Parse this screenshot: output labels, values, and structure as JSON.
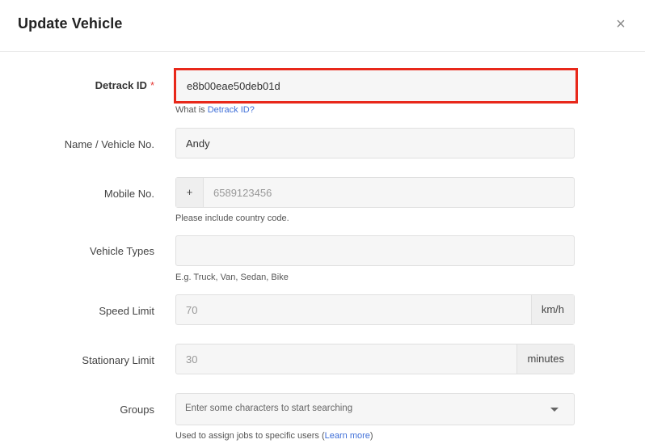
{
  "modal": {
    "title": "Update Vehicle",
    "close_glyph": "×"
  },
  "fields": {
    "detrack_id": {
      "label": "Detrack ID",
      "required_mark": "*",
      "value": "e8b00eae50deb01d",
      "help_prefix": "What is ",
      "help_link": "Detrack ID?"
    },
    "name": {
      "label": "Name / Vehicle No.",
      "value": "Andy"
    },
    "mobile": {
      "label": "Mobile No.",
      "prefix": "+",
      "placeholder": "6589123456",
      "help": "Please include country code."
    },
    "vehicle_types": {
      "label": "Vehicle Types",
      "value": "",
      "help": "E.g. Truck, Van, Sedan, Bike"
    },
    "speed_limit": {
      "label": "Speed Limit",
      "placeholder": "70",
      "suffix": "km/h"
    },
    "stationary_limit": {
      "label": "Stationary Limit",
      "placeholder": "30",
      "suffix": "minutes"
    },
    "groups": {
      "label": "Groups",
      "placeholder": "Enter some characters to start searching",
      "help_prefix": "Used to assign jobs to specific users (",
      "help_link": "Learn more",
      "help_suffix": ")"
    }
  },
  "colors": {
    "highlight_border": "#e8281a",
    "link": "#3f6fd8",
    "required": "#e53935"
  }
}
